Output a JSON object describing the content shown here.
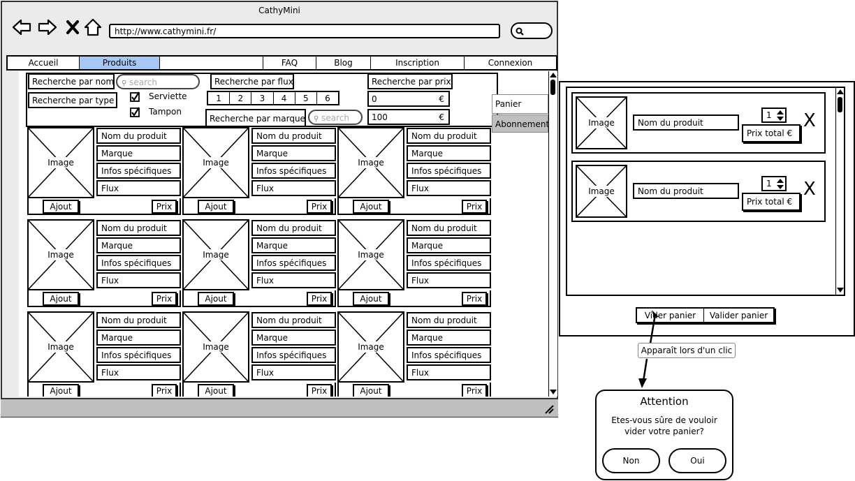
{
  "window": {
    "title": "CathyMini",
    "url": "http://www.cathymini.fr/"
  },
  "nav": {
    "items": [
      "Accueil",
      "Produits",
      "FAQ",
      "Blog",
      "Inscription",
      "Connexion"
    ],
    "active": "Produits"
  },
  "filters": {
    "by_name_label": "Recherche par nom",
    "by_name_placeholder": "search",
    "by_type_label": "Recherche par type",
    "type_options": [
      {
        "label": "Serviette",
        "checked": true
      },
      {
        "label": "Tampon",
        "checked": true
      }
    ],
    "by_flux_label": "Recherche par flux",
    "flux_levels": [
      "1",
      "2",
      "3",
      "4",
      "5",
      "6"
    ],
    "by_brand_label": "Recherche par marque",
    "by_brand_placeholder": "search",
    "by_price_label": "Recherche par prix",
    "price_min": "0",
    "price_max": "100",
    "currency": "€"
  },
  "side_tabs": {
    "panier": "Panier",
    "abonnement": "Abonnement"
  },
  "product_card": {
    "image": "Image",
    "name": "Nom du produit",
    "brand": "Marque",
    "specs": "Infos spécifiques",
    "flux": "Flux",
    "add": "Ajout",
    "price": "Prix"
  },
  "cart": {
    "items": [
      {
        "image": "Image",
        "name": "Nom du produit",
        "qty": "1",
        "total": "Prix total €",
        "remove": "X"
      },
      {
        "image": "Image",
        "name": "Nom du produit",
        "qty": "1",
        "total": "Prix total €",
        "remove": "X"
      }
    ],
    "empty_button": "Vider panier",
    "validate_button": "Valider panier"
  },
  "annotation": "Apparaît lors d'un clic",
  "dialog": {
    "title": "Attention",
    "message_line1": "Etes-vous sûre de vouloir",
    "message_line2": "vider votre panier?",
    "no": "Non",
    "yes": "Oui"
  },
  "icons": [
    "back-arrow-icon",
    "forward-arrow-icon",
    "close-icon",
    "home-icon",
    "search-icon",
    "resize-grip-icon",
    "checkbox-checked-icon",
    "spinner-arrows-icon",
    "image-placeholder-icon"
  ]
}
